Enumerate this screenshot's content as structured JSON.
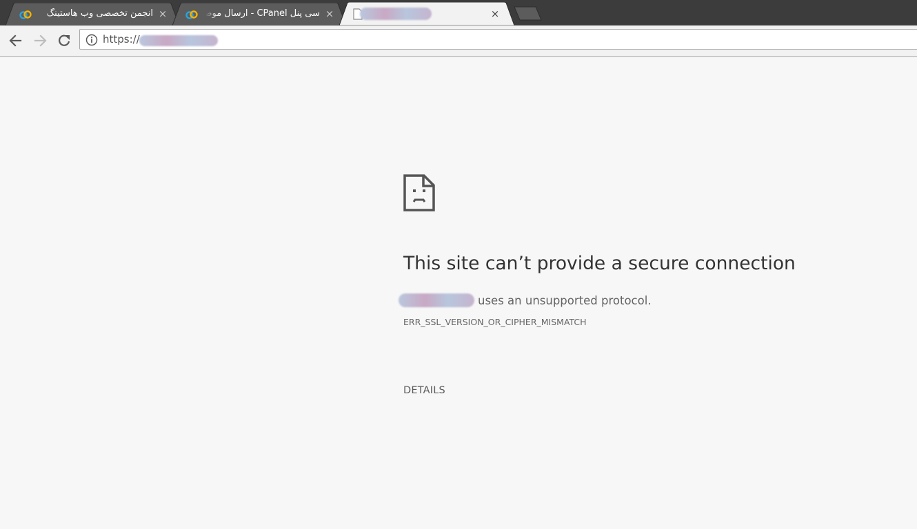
{
  "tabs": [
    {
      "title": "انجمن تخصصی وب هاستینگ",
      "favicon": "forum-logo-icon",
      "active": false,
      "close_label": "×"
    },
    {
      "title": "سی پنل CPanel - ارسال موضوع",
      "favicon": "forum-logo-icon",
      "active": false,
      "close_label": "×"
    },
    {
      "title": "",
      "favicon": "page-icon",
      "active": true,
      "close_label": "×"
    }
  ],
  "toolbar": {
    "back_icon": "back-arrow-icon",
    "forward_icon": "forward-arrow-icon",
    "reload_icon": "reload-icon",
    "address": {
      "info_icon": "info-icon",
      "url": "https://"
    }
  },
  "error_page": {
    "icon": "sad-page-icon",
    "heading": "This site can’t provide a secure connection",
    "summary_suffix": "uses an unsupported protocol.",
    "error_code": "ERR_SSL_VERSION_OR_CIPHER_MISMATCH",
    "details_label": "DETAILS"
  },
  "colors": {
    "tabstrip": "#3c3c3c",
    "inactive_tab": "#5c5c5c",
    "active_tab": "#f2f2f2",
    "page_background": "#f7f7f7",
    "heading_text": "#333333"
  }
}
